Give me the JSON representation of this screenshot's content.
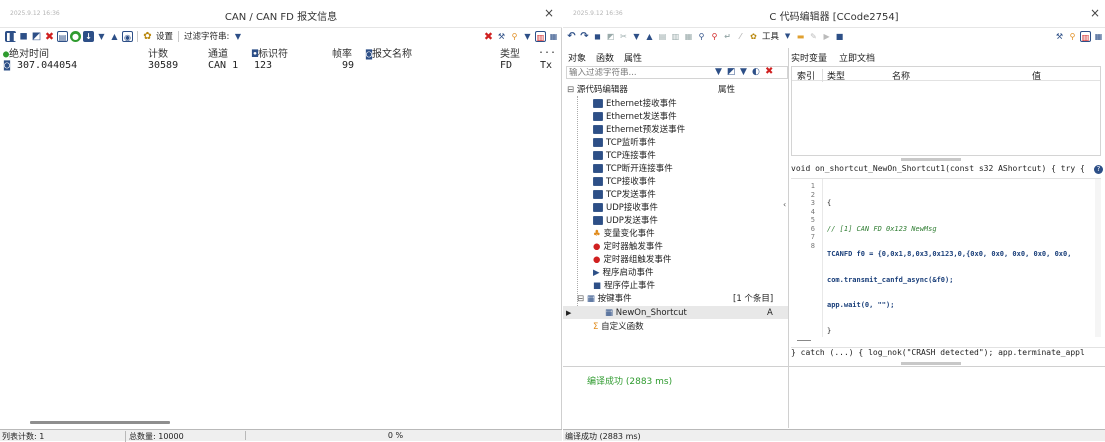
{
  "left": {
    "timestamp": "2025.9.12 16:36",
    "title": "CAN / CAN FD 报文信息",
    "close": "×",
    "toolbar": {
      "settings": "设置",
      "filter": "过滤字符串:"
    },
    "columns": [
      "绝对时间",
      "计数",
      "通道",
      "标识符",
      "帧率",
      "报文名称",
      "类型",
      "..."
    ],
    "row": {
      "time": "307.044054",
      "count": "30589",
      "channel": "CAN 1",
      "id": "123",
      "rate": "99",
      "name": "",
      "type": "FD",
      "dir": "Tx"
    },
    "status": {
      "list_count": "列表计数: 1",
      "total": "总数量: 10000",
      "percent": "0 %"
    }
  },
  "right": {
    "timestamp": "2025.9.12 16:36",
    "title": "C 代码编辑器 [CCode2754]",
    "close": "×",
    "toolbar": {
      "tools": "工具"
    },
    "tabs": [
      "对象",
      "函数",
      "属性"
    ],
    "filter_placeholder": "输入过滤字符串...",
    "tree_root": "源代码编辑器",
    "tree_prop": "属性",
    "tree_items": [
      "Ethernet接收事件",
      "Ethernet发送事件",
      "Ethernet预发送事件",
      "TCP监听事件",
      "TCP连接事件",
      "TCP断开连接事件",
      "TCP接收事件",
      "TCP发送事件",
      "UDP接收事件",
      "UDP发送事件",
      "变量变化事件",
      "定时器触发事件",
      "定时器组触发事件",
      "程序启动事件",
      "程序停止事件"
    ],
    "key_event": "按键事件",
    "key_count": "[1 个条目]",
    "shortcut": "NewOn_Shortcut",
    "shortcut_val": "A",
    "custom_func": "自定义函数",
    "var_tabs": [
      "实时变量",
      "立即文档"
    ],
    "var_cols": [
      "索引",
      "类型",
      "名称",
      "值"
    ],
    "code_header": "void on_shortcut_NewOn_Shortcut1(const s32 AShortcut) { try {",
    "line_numbers": [
      "1",
      "2",
      "3",
      "4",
      "5",
      "6",
      "7",
      "8"
    ],
    "code_lines": [
      "{",
      "// [1] CAN FD 0x123 NewMsg",
      "TCANFD f0 = {0,0x1,8,0x3,0x123,0,{0x0, 0x0, 0x0, 0x0, 0x0,",
      "com.transmit_canfd_async(&f0);",
      "app.wait(0, \"\");",
      "}",
      "",
      ""
    ],
    "code_footer": "} catch (...) { log_nok(\"CRASH detected\"); app.terminate_appl",
    "compile_msg": "编译成功 (2883 ms)",
    "status": "编译成功 (2883 ms)"
  },
  "colors": {
    "blue": "#2d4f87",
    "red": "#d02020",
    "green": "#2f9b2f",
    "orange": "#e08b1c",
    "codegreen": "#2f7d32"
  }
}
